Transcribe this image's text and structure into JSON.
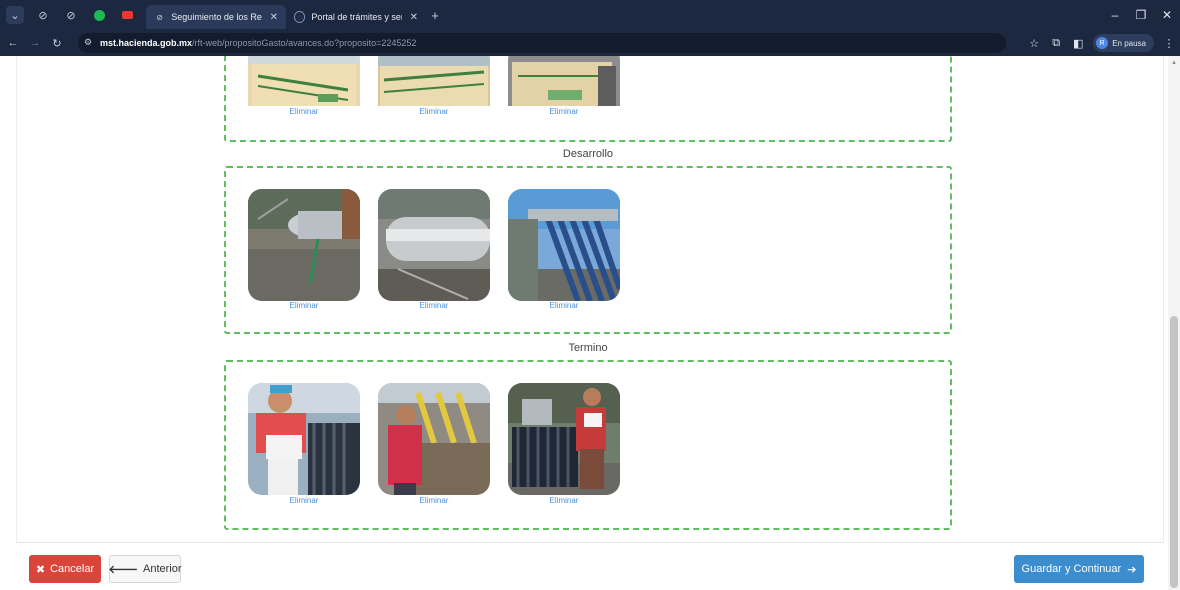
{
  "browser": {
    "tabs": [
      {
        "title": "Seguimiento de los Recursos F",
        "active": true
      },
      {
        "title": "Portal de trámites y servicios - (",
        "active": false
      }
    ],
    "new_tab": "+",
    "url_host": "mst.hacienda.gob.mx",
    "url_path": "/rft-web/propositoGasto/avances.do?proposito=2245252",
    "profile_initial": "R",
    "profile_status": "En pausa",
    "window_controls": {
      "minimize": "–",
      "restore": "❐",
      "close": "✕"
    }
  },
  "sections": [
    {
      "title": "",
      "delete_labels": [
        "Eliminar",
        "Eliminar",
        "Eliminar"
      ]
    },
    {
      "title": "Desarrollo",
      "delete_labels": [
        "Eliminar",
        "Eliminar",
        "Eliminar"
      ]
    },
    {
      "title": "Termino",
      "delete_labels": [
        "Eliminar",
        "Eliminar",
        "Eliminar"
      ]
    }
  ],
  "buttons": {
    "cancel": "Cancelar",
    "previous": "Anterior",
    "save": "Guardar y Continuar"
  },
  "colors": {
    "cancel": "#d9453a",
    "save": "#3c8dce",
    "dashed_border": "#5fbf5f",
    "link": "#4a90d9"
  },
  "icons": {
    "cancel": "x-icon",
    "previous": "arrow-left-icon",
    "save": "arrow-right-icon"
  }
}
